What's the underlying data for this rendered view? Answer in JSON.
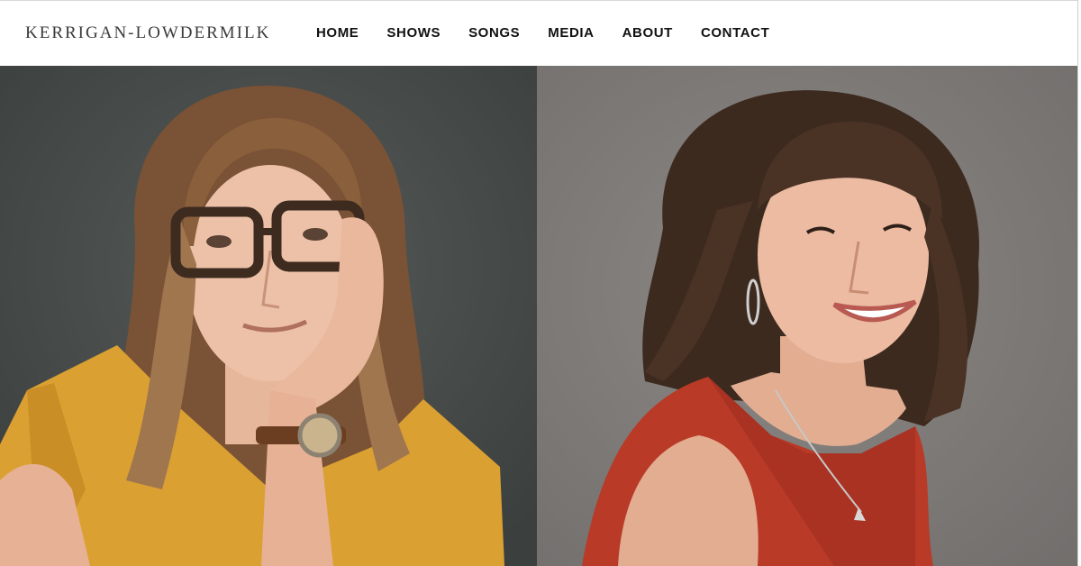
{
  "header": {
    "logo": "KERRIGAN-LOWDERMILK",
    "nav": [
      {
        "label": "HOME"
      },
      {
        "label": "SHOWS"
      },
      {
        "label": "SONGS"
      },
      {
        "label": "MEDIA"
      },
      {
        "label": "ABOUT"
      },
      {
        "label": "CONTACT"
      }
    ]
  },
  "hero": {
    "left_photo": {
      "icon": "portrait-photo",
      "colors": {
        "background": "#474b4a",
        "top": "#e5ac2e",
        "hair": "#8a5f3c"
      }
    },
    "right_photo": {
      "icon": "portrait-photo",
      "colors": {
        "background": "#7e7b79",
        "top": "#b83a27",
        "hair": "#3d2a1f"
      }
    }
  }
}
